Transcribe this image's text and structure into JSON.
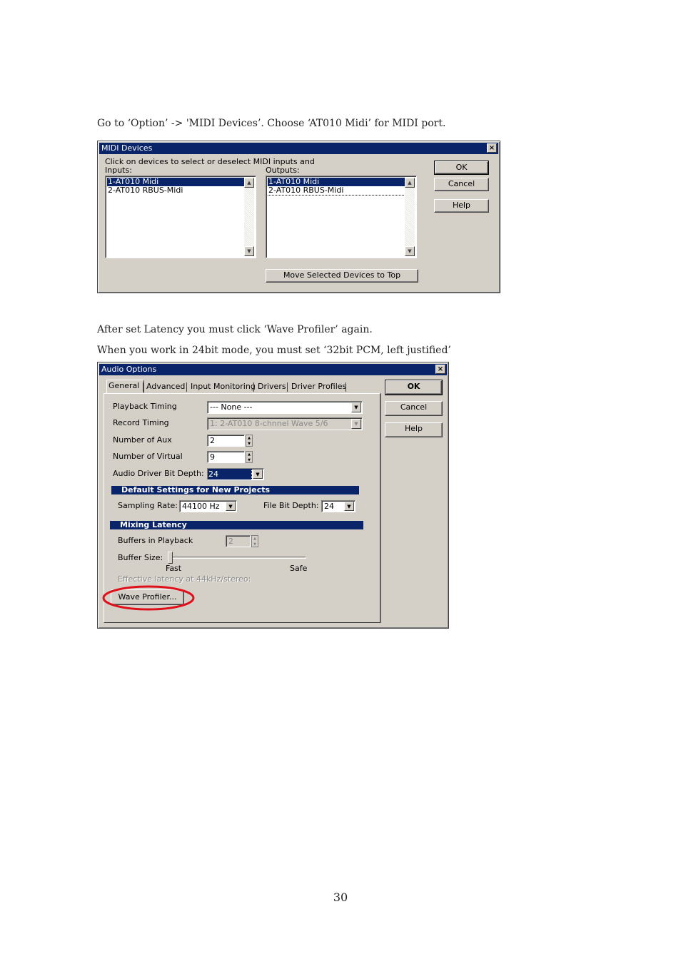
{
  "paragraphs": {
    "p1": "Go to ‘Option’ -> 'MIDI Devices’. Choose ‘AT010 Midi’ for MIDI port.",
    "p2": "After set Latency you must click ‘Wave Profiler’ again.",
    "p3": "When you work in 24bit mode, you must set ‘32bit PCM, left justified’"
  },
  "midi_dialog": {
    "title": "MIDI Devices",
    "close": "×",
    "instruction": "Click on devices to select or deselect MIDI inputs and",
    "inputs_label": "Inputs:",
    "outputs_label": "Outputs:",
    "inputs": [
      "1-AT010 Midi",
      "2-AT010 RBUS-Midi"
    ],
    "outputs": [
      "1-AT010 Midi",
      "2-AT010 RBUS-Midi"
    ],
    "ok": "OK",
    "cancel": "Cancel",
    "help": "Help",
    "move_button": "Move Selected Devices to Top"
  },
  "audio_dialog": {
    "title": "Audio Options",
    "close": "×",
    "tabs": [
      "General",
      "Advanced",
      "Input Monitoring",
      "Drivers",
      "Driver Profiles"
    ],
    "ok": "OK",
    "cancel": "Cancel",
    "help": "Help",
    "playback_timing_label": "Playback Timing",
    "playback_timing_value": "--- None ---",
    "record_timing_label": "Record Timing",
    "record_timing_value": "1: 2-AT010 8-chnnel Wave 5/6",
    "num_aux_label": "Number of Aux",
    "num_aux_value": "2",
    "num_virtual_label": "Number of Virtual",
    "num_virtual_value": "9",
    "bit_depth_label": "Audio Driver Bit Depth:",
    "bit_depth_value": "24",
    "default_settings_header": "Default Settings for New Projects",
    "sampling_rate_label": "Sampling Rate:",
    "sampling_rate_value": "44100 Hz",
    "file_bit_depth_label": "File Bit Depth:",
    "file_bit_depth_value": "24",
    "mixing_latency_header": "Mixing Latency",
    "buffers_label": "Buffers in Playback",
    "buffers_value": "2",
    "buffer_size_label": "Buffer Size:",
    "fast_label": "Fast",
    "safe_label": "Safe",
    "effective_latency_label": "Effective latency at 44kHz/stereo:",
    "wave_profiler_button": "Wave Profiler...",
    "highlight_color": "#e0101a"
  },
  "page_number": "30"
}
